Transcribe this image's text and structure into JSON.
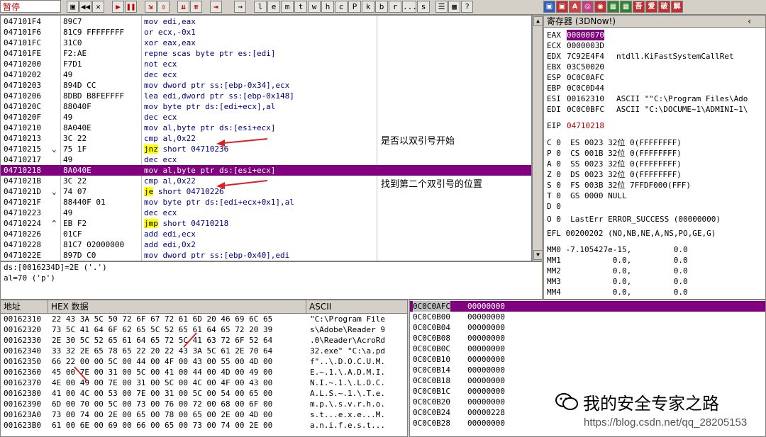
{
  "toolbar": {
    "status": "暂停",
    "letters": [
      "l",
      "e",
      "m",
      "t",
      "w",
      "h",
      "c",
      "P",
      "k",
      "b",
      "r",
      "...",
      "s"
    ],
    "plugin_labels": [
      "A",
      "吾",
      "爱",
      "破",
      "解"
    ]
  },
  "disasm": {
    "rows": [
      {
        "addr": "047101F4",
        "hex": "89C7",
        "ins": "mov edi,eax"
      },
      {
        "addr": "047101F6",
        "hex": "81C9 FFFFFFFF",
        "ins": "or ecx,-0x1"
      },
      {
        "addr": "047101FC",
        "hex": "31C0",
        "ins": "xor eax,eax"
      },
      {
        "addr": "047101FE",
        "hex": "F2:AE",
        "ins": "repne scas byte ptr es:[edi]"
      },
      {
        "addr": "04710200",
        "hex": "F7D1",
        "ins": "not ecx"
      },
      {
        "addr": "04710202",
        "hex": "49",
        "ins": "dec ecx"
      },
      {
        "addr": "04710203",
        "hex": "894D CC",
        "ins": "mov dword ptr ss:[ebp-0x34],ecx"
      },
      {
        "addr": "04710206",
        "hex": "8DBD B8FEFFFF",
        "ins": "lea edi,dword ptr ss:[ebp-0x148]"
      },
      {
        "addr": "0471020C",
        "hex": "88040F",
        "ins": "mov byte ptr ds:[edi+ecx],al"
      },
      {
        "addr": "0471020F",
        "hex": "49",
        "ins": "dec ecx"
      },
      {
        "addr": "04710210",
        "hex": "8A040E",
        "ins": "mov al,byte ptr ds:[esi+ecx]"
      },
      {
        "addr": "04710213",
        "hex": "3C 22",
        "ins": "cmp al,0x22"
      },
      {
        "addr": "04710215",
        "hex": "75 1F",
        "ins": "jnz short 04710236"
      },
      {
        "addr": "04710217",
        "hex": "49",
        "ins": "dec ecx"
      },
      {
        "addr": "04710218",
        "hex": "8A040E",
        "ins": "mov al,byte ptr ds:[esi+ecx]"
      },
      {
        "addr": "0471021B",
        "hex": "3C 22",
        "ins": "cmp al,0x22"
      },
      {
        "addr": "0471021D",
        "hex": "74 07",
        "ins": "je short 04710226"
      },
      {
        "addr": "0471021F",
        "hex": "88440F 01",
        "ins": "mov byte ptr ds:[edi+ecx+0x1],al"
      },
      {
        "addr": "04710223",
        "hex": "49",
        "ins": "dec ecx"
      },
      {
        "addr": "04710224",
        "hex": "EB F2",
        "ins": "jmp short 04710218"
      },
      {
        "addr": "04710226",
        "hex": "01CF",
        "ins": "add edi,ecx"
      },
      {
        "addr": "04710228",
        "hex": "81C7 02000000",
        "ins": "add edi,0x2"
      },
      {
        "addr": "0471022E",
        "hex": "897D C0",
        "ins": "mov dword ptr ss:[ebp-0x40],edi"
      }
    ],
    "comment1": "是否以双引号开始",
    "comment2": "找到第二个双引号的位置"
  },
  "info": {
    "line1": "ds:[0016234D]=2E ('.')",
    "line2": "al=70 ('p')"
  },
  "registers": {
    "title": "寄存器 (3DNow!)",
    "gp": [
      {
        "name": "EAX",
        "val": "00000070",
        "extra": ""
      },
      {
        "name": "ECX",
        "val": "0000003D",
        "extra": ""
      },
      {
        "name": "EDX",
        "val": "7C92E4F4",
        "extra": "ntdll.KiFastSystemCallRet"
      },
      {
        "name": "EBX",
        "val": "03C50020",
        "extra": ""
      },
      {
        "name": "ESP",
        "val": "0C0C0AFC",
        "extra": ""
      },
      {
        "name": "EBP",
        "val": "0C0C0D44",
        "extra": ""
      },
      {
        "name": "ESI",
        "val": "00162310",
        "extra": "ASCII \"\"C:\\Program Files\\Ado"
      },
      {
        "name": "EDI",
        "val": "0C0C0BFC",
        "extra": "ASCII \"C:\\DOCUME~1\\ADMINI~1\\"
      }
    ],
    "eip_name": "EIP",
    "eip_val": "04710218",
    "flags": [
      "C 0  ES 0023 32位 0(FFFFFFFF)",
      "P 0  CS 001B 32位 0(FFFFFFFF)",
      "A 0  SS 0023 32位 0(FFFFFFFF)",
      "Z 0  DS 0023 32位 0(FFFFFFFF)",
      "S 0  FS 003B 32位 7FFDF000(FFF)",
      "T 0  GS 0000 NULL",
      "D 0",
      "O 0  LastErr ERROR_SUCCESS (00000000)"
    ],
    "efl": "EFL 00200202 (NO,NB,NE,A,NS,PO,GE,G)",
    "mm": [
      "MM0 -7.105427e-15,         0.0",
      "MM1           0.0,         0.0",
      "MM2           0.0,         0.0",
      "MM3           0.0,         0.0",
      "MM4           0.0,         0.0"
    ]
  },
  "dump": {
    "headers": {
      "addr": "地址",
      "hex": "HEX 数据",
      "ascii": "ASCII"
    },
    "rows": [
      {
        "addr": "00162310",
        "hex": "22 43 3A 5C 50 72 6F 67 72 61 6D 20 46 69 6C 65",
        "ascii": "\"C:\\Program File"
      },
      {
        "addr": "00162320",
        "hex": "73 5C 41 64 6F 62 65 5C 52 65 61 64 65 72 20 39",
        "ascii": "s\\Adobe\\Reader 9"
      },
      {
        "addr": "00162330",
        "hex": "2E 30 5C 52 65 61 64 65 72 5C 41 63 72 6F 52 64",
        "ascii": ".0\\Reader\\AcroRd"
      },
      {
        "addr": "00162340",
        "hex": "33 32 2E 65 78 65 22 20 22 43 3A 5C 61 2E 70 64",
        "ascii": "32.exe\" \"C:\\a.pd"
      },
      {
        "addr": "00162350",
        "hex": "66 22 00 00 5C 00 44 00 4F 00 43 00 55 00 4D 00",
        "ascii": "f\"..\\.D.O.C.U.M."
      },
      {
        "addr": "00162360",
        "hex": "45 00 7E 00 31 00 5C 00 41 00 44 00 4D 00 49 00",
        "ascii": "E.~.1.\\.A.D.M.I."
      },
      {
        "addr": "00162370",
        "hex": "4E 00 49 00 7E 00 31 00 5C 00 4C 00 4F 00 43 00",
        "ascii": "N.I.~.1.\\.L.O.C."
      },
      {
        "addr": "00162380",
        "hex": "41 00 4C 00 53 00 7E 00 31 00 5C 00 54 00 65 00",
        "ascii": "A.L.S.~.1.\\.T.e."
      },
      {
        "addr": "00162390",
        "hex": "6D 00 70 00 5C 00 73 00 76 00 72 00 68 00 6F 00",
        "ascii": "m.p.\\.s.v.r.h.o."
      },
      {
        "addr": "001623A0",
        "hex": "73 00 74 00 2E 00 65 00 78 00 65 00 2E 00 4D 00",
        "ascii": "s.t...e.x.e...M."
      },
      {
        "addr": "001623B0",
        "hex": "61 00 6E 00 69 00 66 00 65 00 73 00 74 00 2E 00",
        "ascii": "a.n.i.f.e.s.t..."
      }
    ]
  },
  "stack": {
    "rows": [
      {
        "addr": "0C0C0AFC",
        "val": "00000000"
      },
      {
        "addr": "0C0C0B00",
        "val": "00000000"
      },
      {
        "addr": "0C0C0B04",
        "val": "00000000"
      },
      {
        "addr": "0C0C0B08",
        "val": "00000000"
      },
      {
        "addr": "0C0C0B0C",
        "val": "00000000"
      },
      {
        "addr": "0C0C0B10",
        "val": "00000000"
      },
      {
        "addr": "0C0C0B14",
        "val": "00000000"
      },
      {
        "addr": "0C0C0B18",
        "val": "00000000"
      },
      {
        "addr": "0C0C0B1C",
        "val": "00000000"
      },
      {
        "addr": "0C0C0B20",
        "val": "00000000"
      },
      {
        "addr": "0C0C0B24",
        "val": "00000228"
      },
      {
        "addr": "0C0C0B28",
        "val": "00000000"
      }
    ]
  },
  "watermark": {
    "text": "我的安全专家之路",
    "url": "https://blog.csdn.net/qq_28205153"
  },
  "colors": {
    "highlight": "#800080",
    "accent_red": "#c00000",
    "jump_yellow": "#ffff00"
  }
}
